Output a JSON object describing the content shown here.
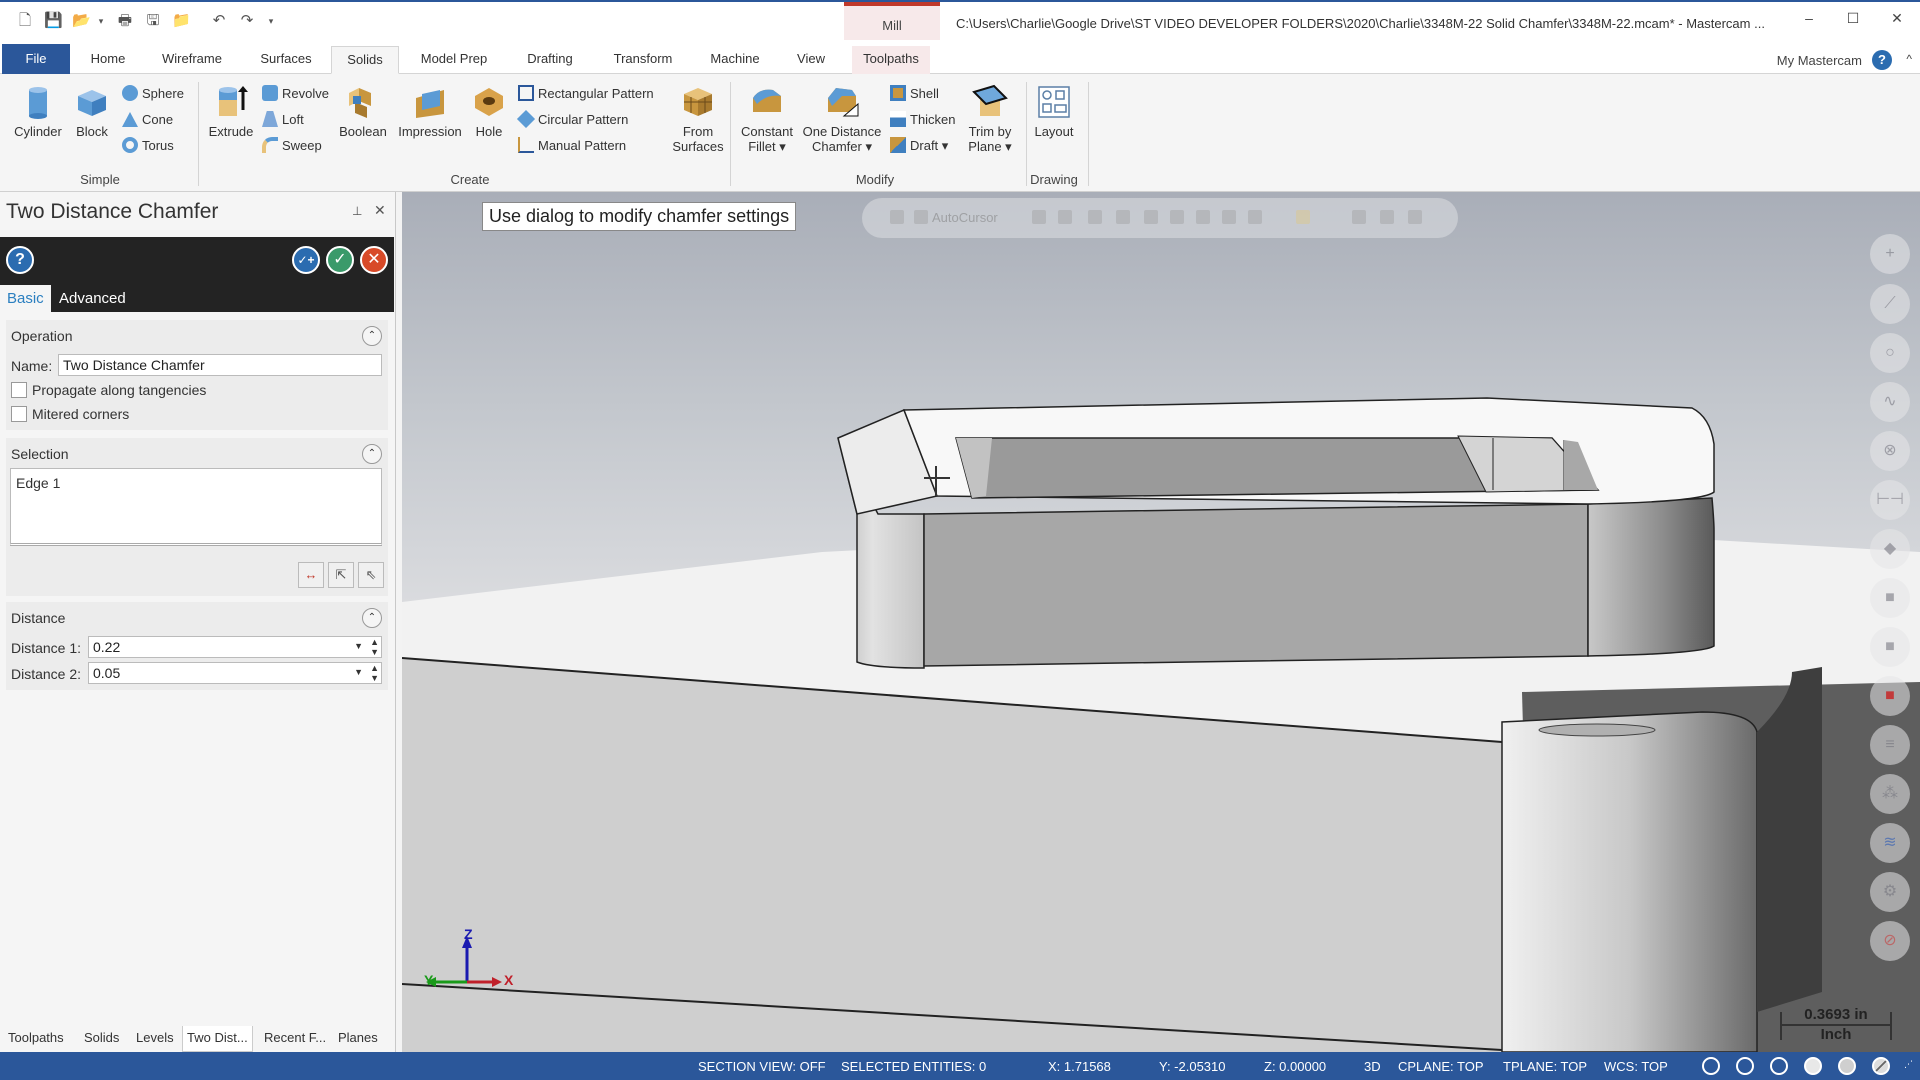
{
  "title_bar": {
    "quick_access": [
      "new-file",
      "save",
      "open",
      "print",
      "save-as",
      "folder-settings",
      "undo",
      "redo",
      "customize"
    ],
    "context_tab_label": "Mill",
    "path": "C:\\Users\\Charlie\\Google Drive\\ST VIDEO DEVELOPER FOLDERS\\2020\\Charlie\\3348M-22 Solid Chamfer\\3348M-22.mcam* - Mastercam ...",
    "minimize": "–",
    "maximize": "☐",
    "close": "✕"
  },
  "ribbon_tabs": {
    "items": [
      "File",
      "Home",
      "Wireframe",
      "Surfaces",
      "Solids",
      "Model Prep",
      "Drafting",
      "Transform",
      "Machine",
      "View",
      "Toolpaths"
    ],
    "active": "Solids",
    "my_mastercam": "My Mastercam",
    "help": "?",
    "collapse": "^"
  },
  "ribbon": {
    "groups": {
      "simple": "Simple",
      "create": "Create",
      "modify": "Modify",
      "drawing": "Drawing"
    },
    "buttons": {
      "cylinder": "Cylinder",
      "block": "Block",
      "sphere": "Sphere",
      "cone": "Cone",
      "torus": "Torus",
      "extrude": "Extrude",
      "revolve": "Revolve",
      "loft": "Loft",
      "sweep": "Sweep",
      "boolean": "Boolean",
      "impression": "Impression",
      "hole": "Hole",
      "rectangular_pattern": "Rectangular Pattern",
      "circular_pattern": "Circular Pattern",
      "manual_pattern": "Manual Pattern",
      "from_surfaces_1": "From",
      "from_surfaces_2": "Surfaces",
      "constant_fillet_1": "Constant",
      "constant_fillet_2": "Fillet ▾",
      "one_distance_chamfer_1": "One Distance",
      "one_distance_chamfer_2": "Chamfer ▾",
      "shell": "Shell",
      "thicken": "Thicken",
      "draft": "Draft ▾",
      "trim_by_plane_1": "Trim by",
      "trim_by_plane_2": "Plane ▾",
      "layout": "Layout"
    }
  },
  "panel": {
    "title": "Two Distance Chamfer",
    "pin": "📌",
    "close": "✕",
    "toolbar": {
      "help": "?",
      "ok_new": "✓+",
      "ok": "✓",
      "cancel": "✕"
    },
    "tabs": {
      "basic": "Basic",
      "advanced": "Advanced",
      "active": "Basic"
    },
    "operation": {
      "title": "Operation",
      "name_label": "Name:",
      "name_value": "Two Distance Chamfer",
      "propagate_label": "Propagate along tangencies",
      "propagate_checked": false,
      "mitered_label": "Mitered corners",
      "mitered_checked": false
    },
    "selection": {
      "title": "Selection",
      "items": [
        "Edge 1"
      ]
    },
    "distance": {
      "title": "Distance",
      "distance1_label": "Distance 1:",
      "distance1_value": "0.22",
      "distance2_label": "Distance 2:",
      "distance2_value": "0.05"
    },
    "bottom_tabs": [
      "Toolpaths",
      "Solids",
      "Levels",
      "Two Dist...",
      "Recent F...",
      "Planes"
    ],
    "bottom_active": "Two Dist..."
  },
  "viewport": {
    "prompt": "Use dialog to modify chamfer settings",
    "autocursor_label": "AutoCursor",
    "scale_value": "0.3693 in",
    "scale_unit": "Inch",
    "axes": {
      "x": "X",
      "y": "Y",
      "z": "Z"
    },
    "side_buttons": [
      "point",
      "line",
      "circle",
      "spline",
      "solid",
      "dimension",
      "color-1",
      "color-2",
      "level",
      "color-3",
      "attributes",
      "analysis",
      "layers",
      "settings",
      "clear"
    ]
  },
  "status_bar": {
    "section_view": "SECTION VIEW: OFF",
    "selected_entities": "SELECTED ENTITIES: 0",
    "x": "X:  1.71568",
    "y": "Y:  -2.05310",
    "z": "Z:  0.00000",
    "mode": "3D",
    "cplane": "CPLANE: TOP",
    "tplane": "TPLANE: TOP",
    "wcs": "WCS: TOP"
  },
  "colors": {
    "accent": "#2b579a",
    "mill_context": "#c0392b",
    "panel_header": "#232323"
  }
}
